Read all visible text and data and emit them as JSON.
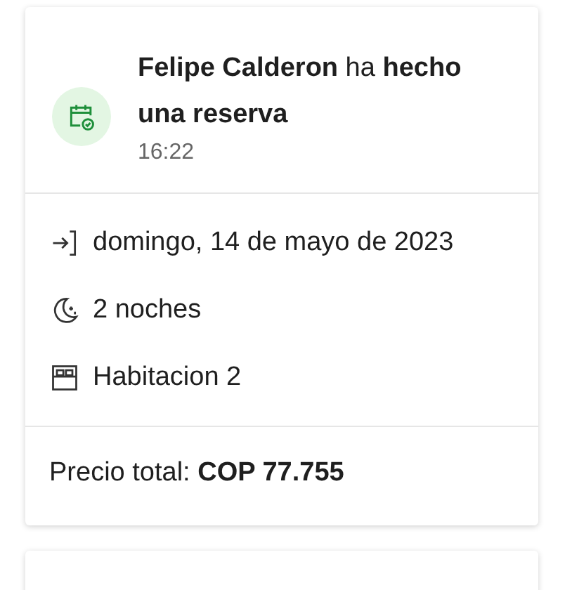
{
  "notification": {
    "message": "**Felipe Calderon** ha **hecho una reserva**",
    "time": "16:22"
  },
  "details": [
    {
      "kind": "check-in",
      "text": "domingo, 14 de mayo de 2023"
    },
    {
      "kind": "nights",
      "text": "2 noches"
    },
    {
      "kind": "room",
      "text": "Habitacion 2"
    }
  ],
  "total": "Precio total: **COP 77.755**"
}
